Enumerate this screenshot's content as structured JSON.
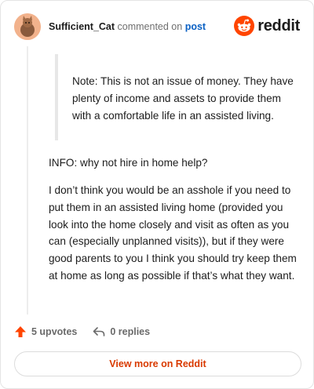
{
  "header": {
    "username": "Sufficient_Cat",
    "verb": "commented on",
    "post_link": "post",
    "logo_icon": "reddit-snoo-icon",
    "logo_text": "reddit"
  },
  "comment": {
    "quote": "Note: This is not an issue of money. They have plenty of income and assets to provide them with a comfortable life in an assisted living.",
    "paragraphs": [
      "INFO: why not hire in home help?",
      "I don’t think you would be an asshole if you need to put them in an assisted living home (provided you look into the home closely and visit as often as you can (especially unplanned visits)), but if they were good parents to you I think you should try keep them at home as long as possible if that’s what they want."
    ]
  },
  "actions": {
    "upvotes": "5 upvotes",
    "replies": "0 replies"
  },
  "footer": {
    "view_more": "View more on Reddit"
  },
  "colors": {
    "accent": "#d93a00",
    "link": "#0b61c4",
    "upvote": "#ff4500"
  }
}
